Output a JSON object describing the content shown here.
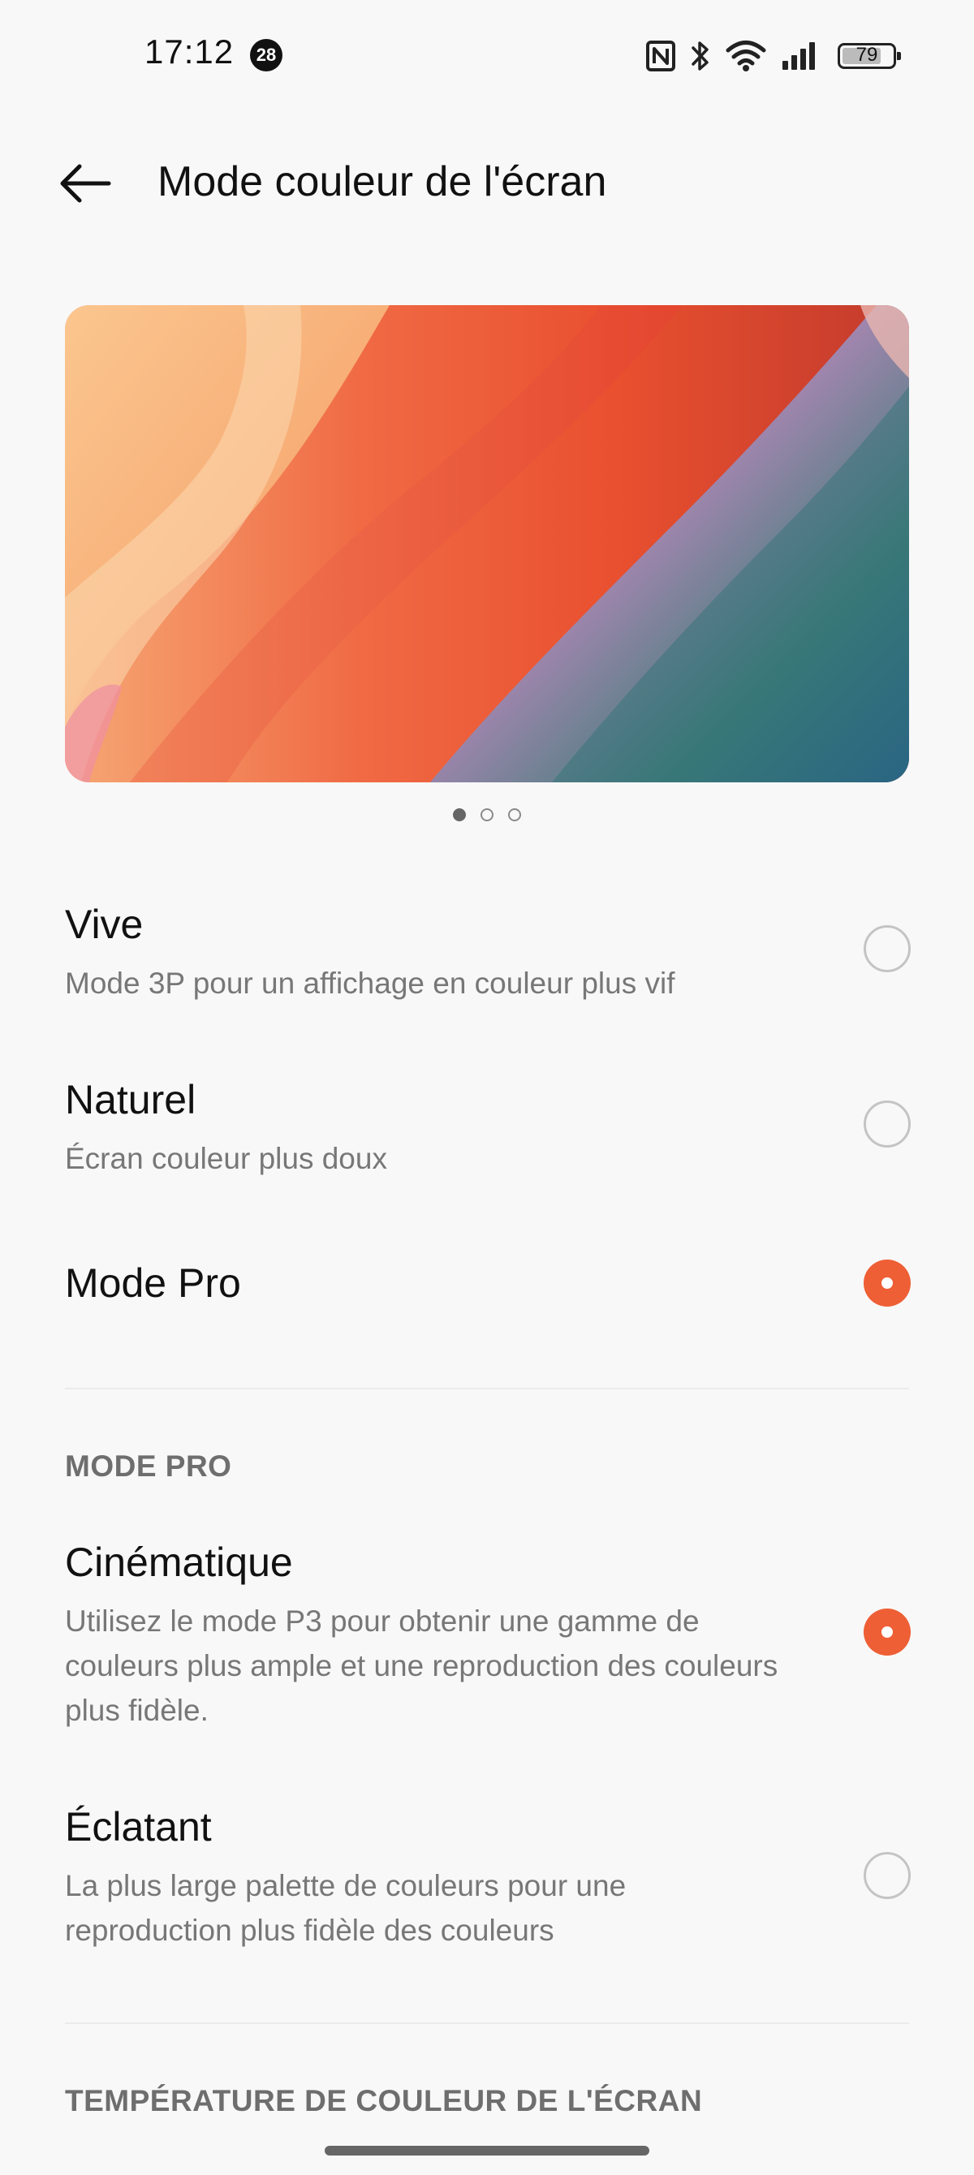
{
  "status_bar": {
    "time": "17:12",
    "notification_count": "28",
    "battery_level": "79",
    "battery_fraction": 0.79,
    "icons": [
      "nfc-icon",
      "bluetooth-icon",
      "wifi-icon",
      "signal-icon",
      "battery-icon"
    ]
  },
  "header": {
    "title": "Mode couleur de l'écran",
    "back_icon": "arrow-left-icon"
  },
  "preview": {
    "pager_count": 3,
    "pager_active_index": 0
  },
  "options": [
    {
      "title": "Vive",
      "description": "Mode 3P pour un affichage en couleur plus vif",
      "selected": false
    },
    {
      "title": "Naturel",
      "description": "Écran couleur plus doux",
      "selected": false
    },
    {
      "title": "Mode Pro",
      "description": "",
      "selected": true
    }
  ],
  "pro_section": {
    "header": "MODE PRO",
    "options": [
      {
        "title": "Cinématique",
        "description": "Utilisez le mode P3 pour obtenir une gamme de couleurs plus ample et une reproduction des couleurs plus fidèle.",
        "selected": true
      },
      {
        "title": "Éclatant",
        "description": "La plus large palette de couleurs pour une reproduction plus fidèle des couleurs",
        "selected": false
      }
    ]
  },
  "temperature_section": {
    "header": "TEMPÉRATURE DE COULEUR DE L'ÉCRAN"
  },
  "colors": {
    "accent": "#ee5f35",
    "background": "#f8f8f8",
    "secondary_text": "#777777"
  }
}
